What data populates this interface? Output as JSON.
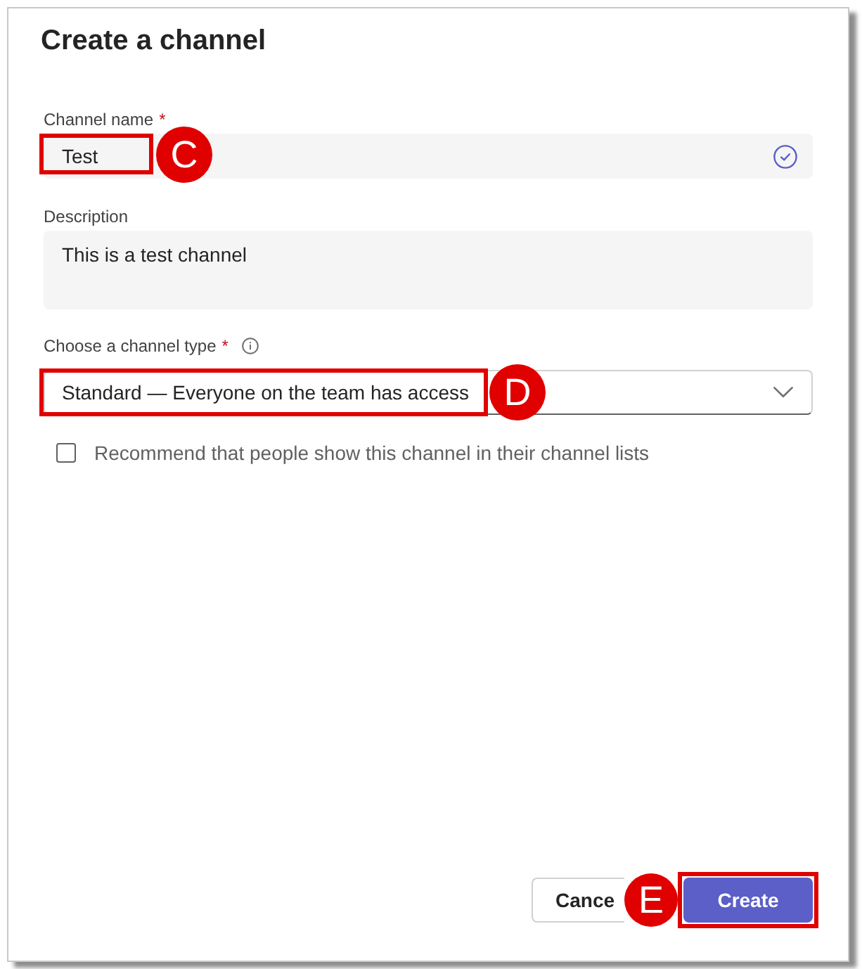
{
  "dialog": {
    "title": "Create a channel"
  },
  "fields": [
    {
      "kind": "text",
      "label": "Channel name",
      "required_mark": "*",
      "value": "Test",
      "valid": true,
      "callout": "C"
    },
    {
      "kind": "textarea",
      "label": "Description",
      "value": "This is a test channel"
    },
    {
      "kind": "select",
      "label": "Choose a channel type",
      "required_mark": "*",
      "info": true,
      "value": "Standard — Everyone on the team has access",
      "callout": "D"
    }
  ],
  "checkbox": {
    "label": "Recommend that people show this channel in their channel lists",
    "checked": false
  },
  "buttons": [
    {
      "kind": "secondary",
      "label": "Cance"
    },
    {
      "kind": "primary",
      "label": "Create",
      "callout": "E"
    }
  ]
}
